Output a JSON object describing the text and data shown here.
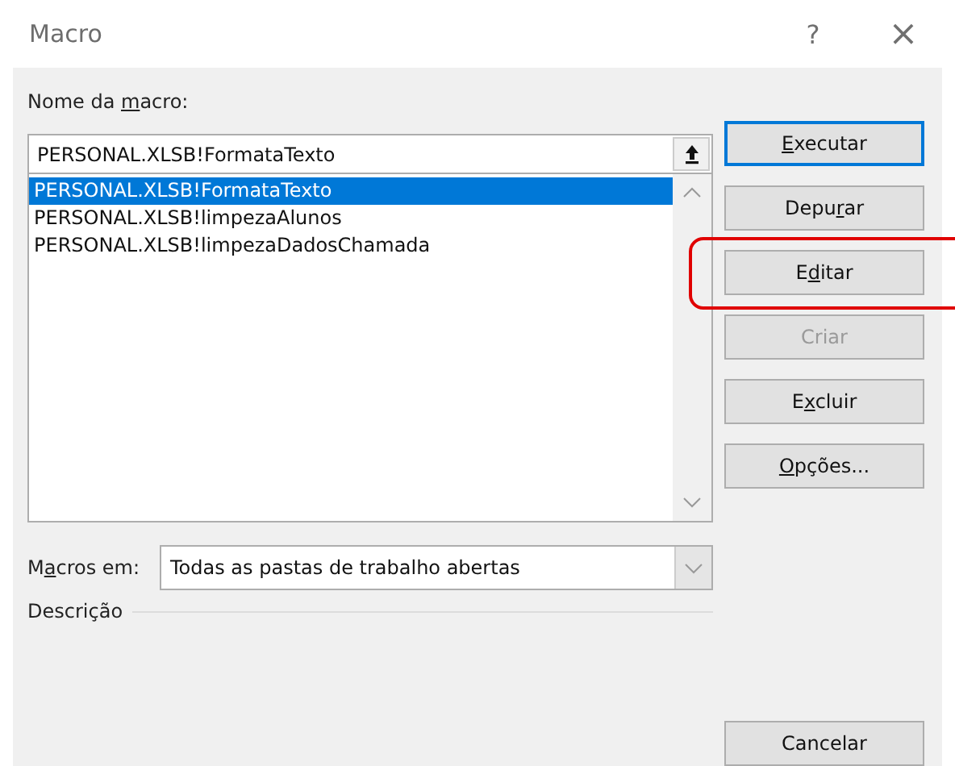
{
  "window": {
    "title": "Macro",
    "help": "?",
    "close": "×"
  },
  "macro_name": {
    "label_parts": {
      "before": "Nome da ",
      "key": "m",
      "after": "acro:"
    },
    "value": "PERSONAL.XLSB!FormataTexto"
  },
  "macro_list": [
    {
      "label": "PERSONAL.XLSB!FormataTexto",
      "selected": true
    },
    {
      "label": "PERSONAL.XLSB!limpezaAlunos",
      "selected": false
    },
    {
      "label": "PERSONAL.XLSB!limpezaDadosChamada",
      "selected": false
    }
  ],
  "buttons": [
    {
      "label_parts": {
        "key": "E",
        "after": "xecutar"
      },
      "default": true,
      "disabled": false,
      "highlighted": false
    },
    {
      "label_parts": {
        "before": "Depu",
        "key": "r",
        "after": "ar"
      },
      "default": false,
      "disabled": false,
      "highlighted": false
    },
    {
      "label_parts": {
        "before": "E",
        "key": "d",
        "after": "itar"
      },
      "default": false,
      "disabled": false,
      "highlighted": true
    },
    {
      "label_parts": {
        "before": "Criar"
      },
      "default": false,
      "disabled": true,
      "highlighted": false
    },
    {
      "label_parts": {
        "before": "E",
        "key": "x",
        "after": "cluir"
      },
      "default": false,
      "disabled": false,
      "highlighted": false
    },
    {
      "label_parts": {
        "key": "O",
        "after": "pções..."
      },
      "default": false,
      "disabled": false,
      "highlighted": false
    }
  ],
  "macros_in": {
    "label_parts": {
      "before": "M",
      "key": "a",
      "after": "cros em:"
    },
    "value": "Todas as pastas de trabalho abertas"
  },
  "description": {
    "label": "Descrição"
  },
  "cancel": {
    "label": "Cancelar"
  }
}
